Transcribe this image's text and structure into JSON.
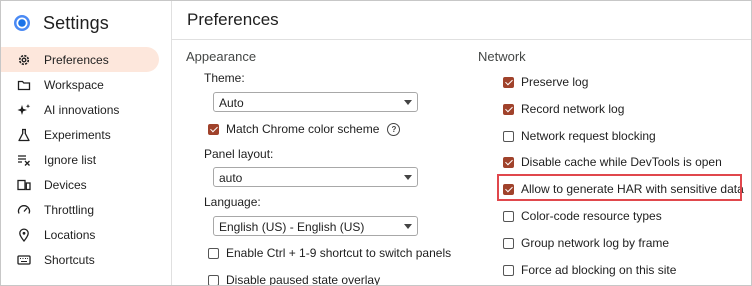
{
  "sidebar": {
    "title": "Settings",
    "items": [
      {
        "label": "Preferences",
        "icon": "gear-icon",
        "active": true
      },
      {
        "label": "Workspace",
        "icon": "folder-icon"
      },
      {
        "label": "AI innovations",
        "icon": "sparkle-icon"
      },
      {
        "label": "Experiments",
        "icon": "flask-icon"
      },
      {
        "label": "Ignore list",
        "icon": "ignore-list-icon"
      },
      {
        "label": "Devices",
        "icon": "devices-icon"
      },
      {
        "label": "Throttling",
        "icon": "gauge-icon"
      },
      {
        "label": "Locations",
        "icon": "location-pin-icon"
      },
      {
        "label": "Shortcuts",
        "icon": "keyboard-icon"
      }
    ]
  },
  "main": {
    "title": "Preferences",
    "appearance": {
      "title": "Appearance",
      "theme_label": "Theme:",
      "theme_value": "Auto",
      "match_chrome": {
        "label": "Match Chrome color scheme",
        "checked": true
      },
      "panel_layout_label": "Panel layout:",
      "panel_layout_value": "auto",
      "language_label": "Language:",
      "language_value": "English (US) - English (US)",
      "ctrl_shortcut": {
        "label": "Enable Ctrl + 1-9 shortcut to switch panels",
        "checked": false
      },
      "paused_overlay": {
        "label": "Disable paused state overlay",
        "checked": false
      }
    },
    "network": {
      "title": "Network",
      "options": [
        {
          "label": "Preserve log",
          "checked": true
        },
        {
          "label": "Record network log",
          "checked": true
        },
        {
          "label": "Network request blocking",
          "checked": false
        },
        {
          "label": "Disable cache while DevTools is open",
          "checked": true
        },
        {
          "label": "Allow to generate HAR with sensitive data",
          "checked": true,
          "help": true
        },
        {
          "label": "Color-code resource types",
          "checked": false
        },
        {
          "label": "Group network log by frame",
          "checked": false
        },
        {
          "label": "Force ad blocking on this site",
          "checked": false
        }
      ]
    }
  },
  "colors": {
    "accent": "#a0422b",
    "active_nav": "#fde7dc",
    "highlight": "#e0474c"
  }
}
